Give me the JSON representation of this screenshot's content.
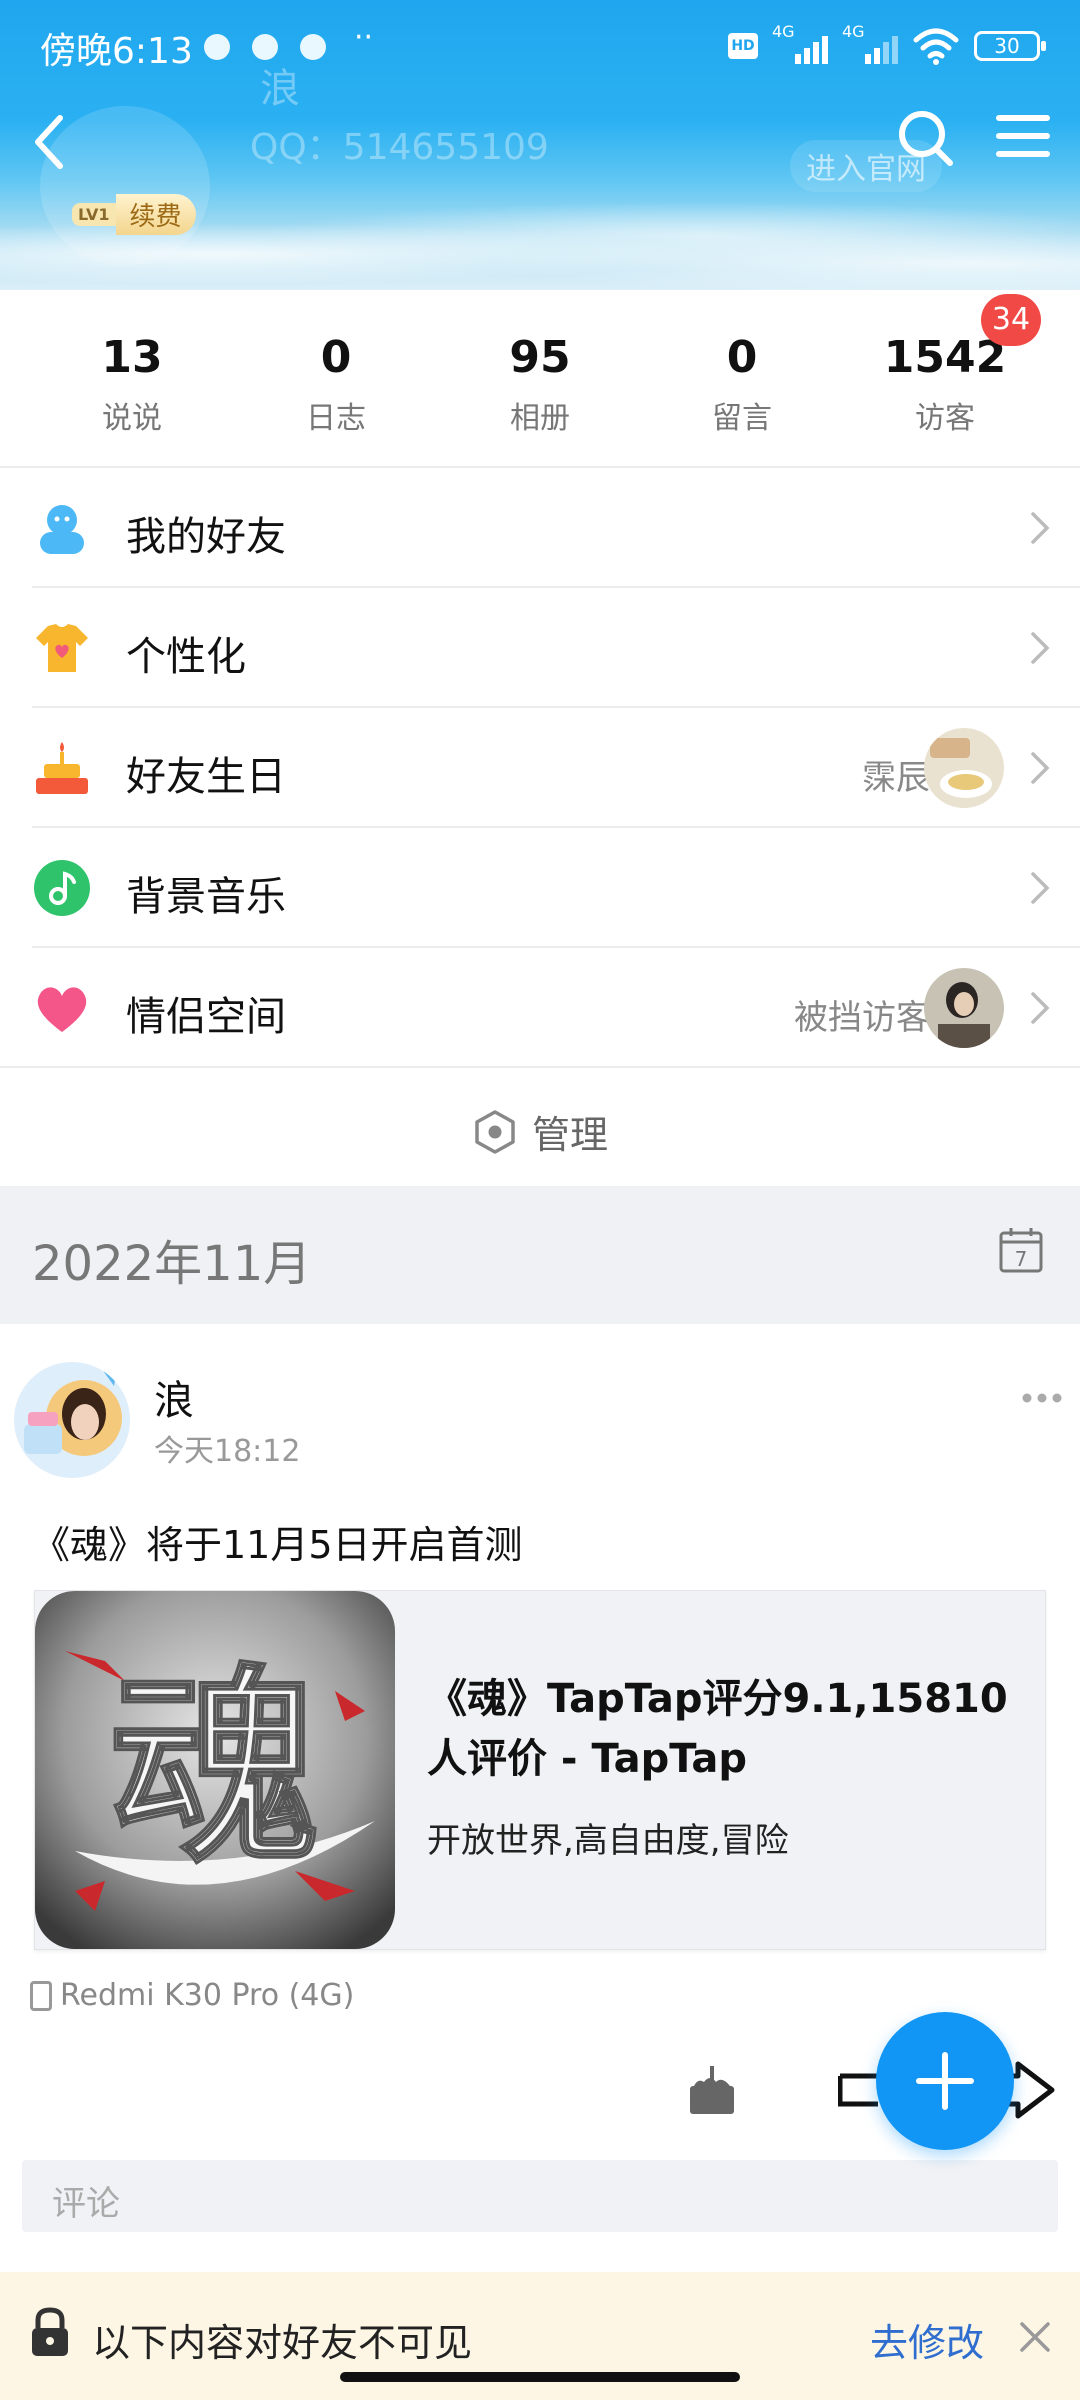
{
  "status_bar": {
    "time": "傍晚6:13",
    "dots": "··",
    "hd": "HD",
    "net1": "4G",
    "net2": "4G",
    "battery": "30"
  },
  "header": {
    "name": "浪",
    "qq": "QQ：514655109",
    "enter_site": "进入官网",
    "level": "LV1",
    "renew": "续费"
  },
  "stats": [
    {
      "num": "13",
      "label": "说说"
    },
    {
      "num": "0",
      "label": "日志"
    },
    {
      "num": "95",
      "label": "相册"
    },
    {
      "num": "0",
      "label": "留言"
    },
    {
      "num": "1542",
      "label": "访客"
    }
  ],
  "visitor_badge": "34",
  "menu": [
    {
      "label": "我的好友",
      "icon": "friends-icon",
      "sub": ""
    },
    {
      "label": "个性化",
      "icon": "tshirt-icon",
      "sub": ""
    },
    {
      "label": "好友生日",
      "icon": "birthday-cake-icon",
      "sub": "霂辰"
    },
    {
      "label": "背景音乐",
      "icon": "music-note-icon",
      "sub": ""
    },
    {
      "label": "情侣空间",
      "icon": "heart-icon",
      "sub": "被挡访客"
    }
  ],
  "manage_label": "管理",
  "month": "2022年11月",
  "calendar_day": "7",
  "post": {
    "author": "浪",
    "time": "今天18:12",
    "text": "《魂》将于11月5日开启首测",
    "link_title": "《魂》TapTap评分9.1,15810 人评价 - TapTap",
    "link_desc": "开放世界,高自由度,冒险",
    "thumb_char": "魂",
    "device": "Redmi K30 Pro (4G)",
    "comment_placeholder": "评论"
  },
  "privacy": {
    "text": "以下内容对好友不可见",
    "action": "去修改"
  },
  "colors": {
    "header_blue": "#1fa6ee",
    "fab_blue": "#1296f5",
    "badge_red": "#f14a46",
    "link_blue": "#2f6ecf"
  }
}
